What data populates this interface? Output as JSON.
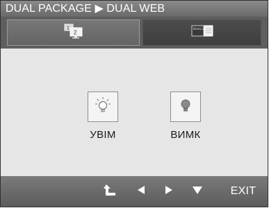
{
  "header": {
    "title": "DUAL PACKAGE ▶ DUAL WEB"
  },
  "tabs": [
    {
      "icon": "dual-monitor-icon",
      "selected": true
    },
    {
      "icon": "dual-web-icon",
      "icon_text": "DUAL WEB",
      "selected": false
    }
  ],
  "options": [
    {
      "label": "УВІМ",
      "icon": "bulb-on-icon"
    },
    {
      "label": "ВИМК",
      "icon": "bulb-off-icon"
    }
  ],
  "footer": {
    "buttons": [
      {
        "icon": "return-arrow-icon"
      },
      {
        "icon": "arrow-left-icon"
      },
      {
        "icon": "arrow-right-icon"
      },
      {
        "icon": "arrow-down-icon"
      }
    ],
    "exit_label": "EXIT"
  },
  "colors": {
    "title_bar": "#7a7a7a",
    "tab_bar": "#5e5e5e",
    "content_bg": "#e6e6e6",
    "nav_bar": "#6a6a6a",
    "text_light": "#ffffff",
    "text_dark": "#1a1a1a"
  }
}
